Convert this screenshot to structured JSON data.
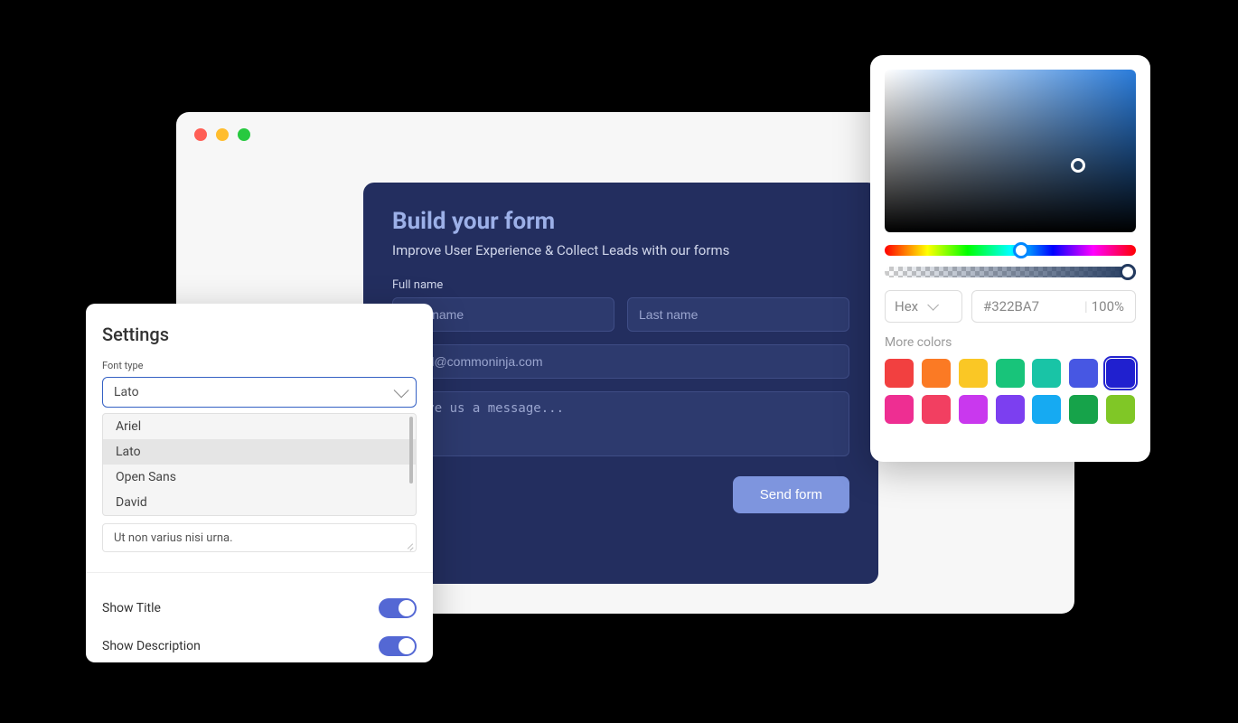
{
  "form": {
    "title": "Build your form",
    "subtitle": "Improve User Experience & Collect Leads with our forms",
    "full_name_label": "Full name",
    "first_name_placeholder": "First name",
    "last_name_placeholder": "Last name",
    "email_placeholder": "email@commoninja.com",
    "message_placeholder": "Leave us a message...",
    "send_label": "Send form"
  },
  "settings": {
    "title": "Settings",
    "font_type_label": "Font type",
    "font_selected": "Lato",
    "font_options": [
      "Ariel",
      "Lato",
      "Open Sans",
      "David"
    ],
    "example_text": "Ut non varius nisi urna.",
    "show_title_label": "Show Title",
    "show_description_label": "Show Description"
  },
  "color": {
    "format": "Hex",
    "hex_value": "#322BA7",
    "opacity": "100%",
    "more_colors_label": "More colors",
    "swatches": [
      {
        "hex": "#f24040"
      },
      {
        "hex": "#fb7a24"
      },
      {
        "hex": "#fac725"
      },
      {
        "hex": "#18c47a"
      },
      {
        "hex": "#19c4a6"
      },
      {
        "hex": "#4757e3"
      },
      {
        "hex": "#2020cf",
        "selected": true
      },
      {
        "hex": "#ee2e92"
      },
      {
        "hex": "#f23f61"
      },
      {
        "hex": "#c938ee"
      },
      {
        "hex": "#7c3ff0"
      },
      {
        "hex": "#16aaf2"
      },
      {
        "hex": "#16a34a"
      },
      {
        "hex": "#80c726"
      }
    ]
  }
}
